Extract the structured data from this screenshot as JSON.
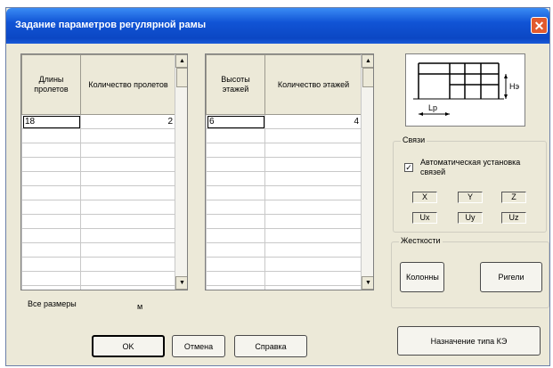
{
  "window": {
    "title": "Задание параметров регулярной рамы",
    "close_glyph": "✕"
  },
  "spans_grid": {
    "headers": [
      "Длины пролетов",
      "Количество пролетов"
    ],
    "rows": [
      [
        "18",
        "2"
      ]
    ],
    "empty_rows": 12
  },
  "floors_grid": {
    "headers": [
      "Высоты этажей",
      "Количество этажей"
    ],
    "rows": [
      [
        "6",
        "4"
      ]
    ],
    "empty_rows": 12
  },
  "units": {
    "label": "Все размеры",
    "value": "м"
  },
  "frame_diagram": {
    "span_label": "Lp",
    "height_label": "Hэ"
  },
  "links": {
    "title": "Связи",
    "auto_checkbox": {
      "label": "Автоматическая установка связей",
      "checked": true,
      "glyph": "✓"
    },
    "dofs": [
      "X",
      "Y",
      "Z",
      "Ux",
      "Uy",
      "Uz"
    ]
  },
  "stiffness": {
    "title": "Жесткости",
    "columns_button": "Колонны",
    "beams_button": "Ригели"
  },
  "buttons": {
    "ok": "OK",
    "cancel": "Отмена",
    "help": "Справка",
    "assign_fe_type": "Назначение типа КЭ"
  }
}
